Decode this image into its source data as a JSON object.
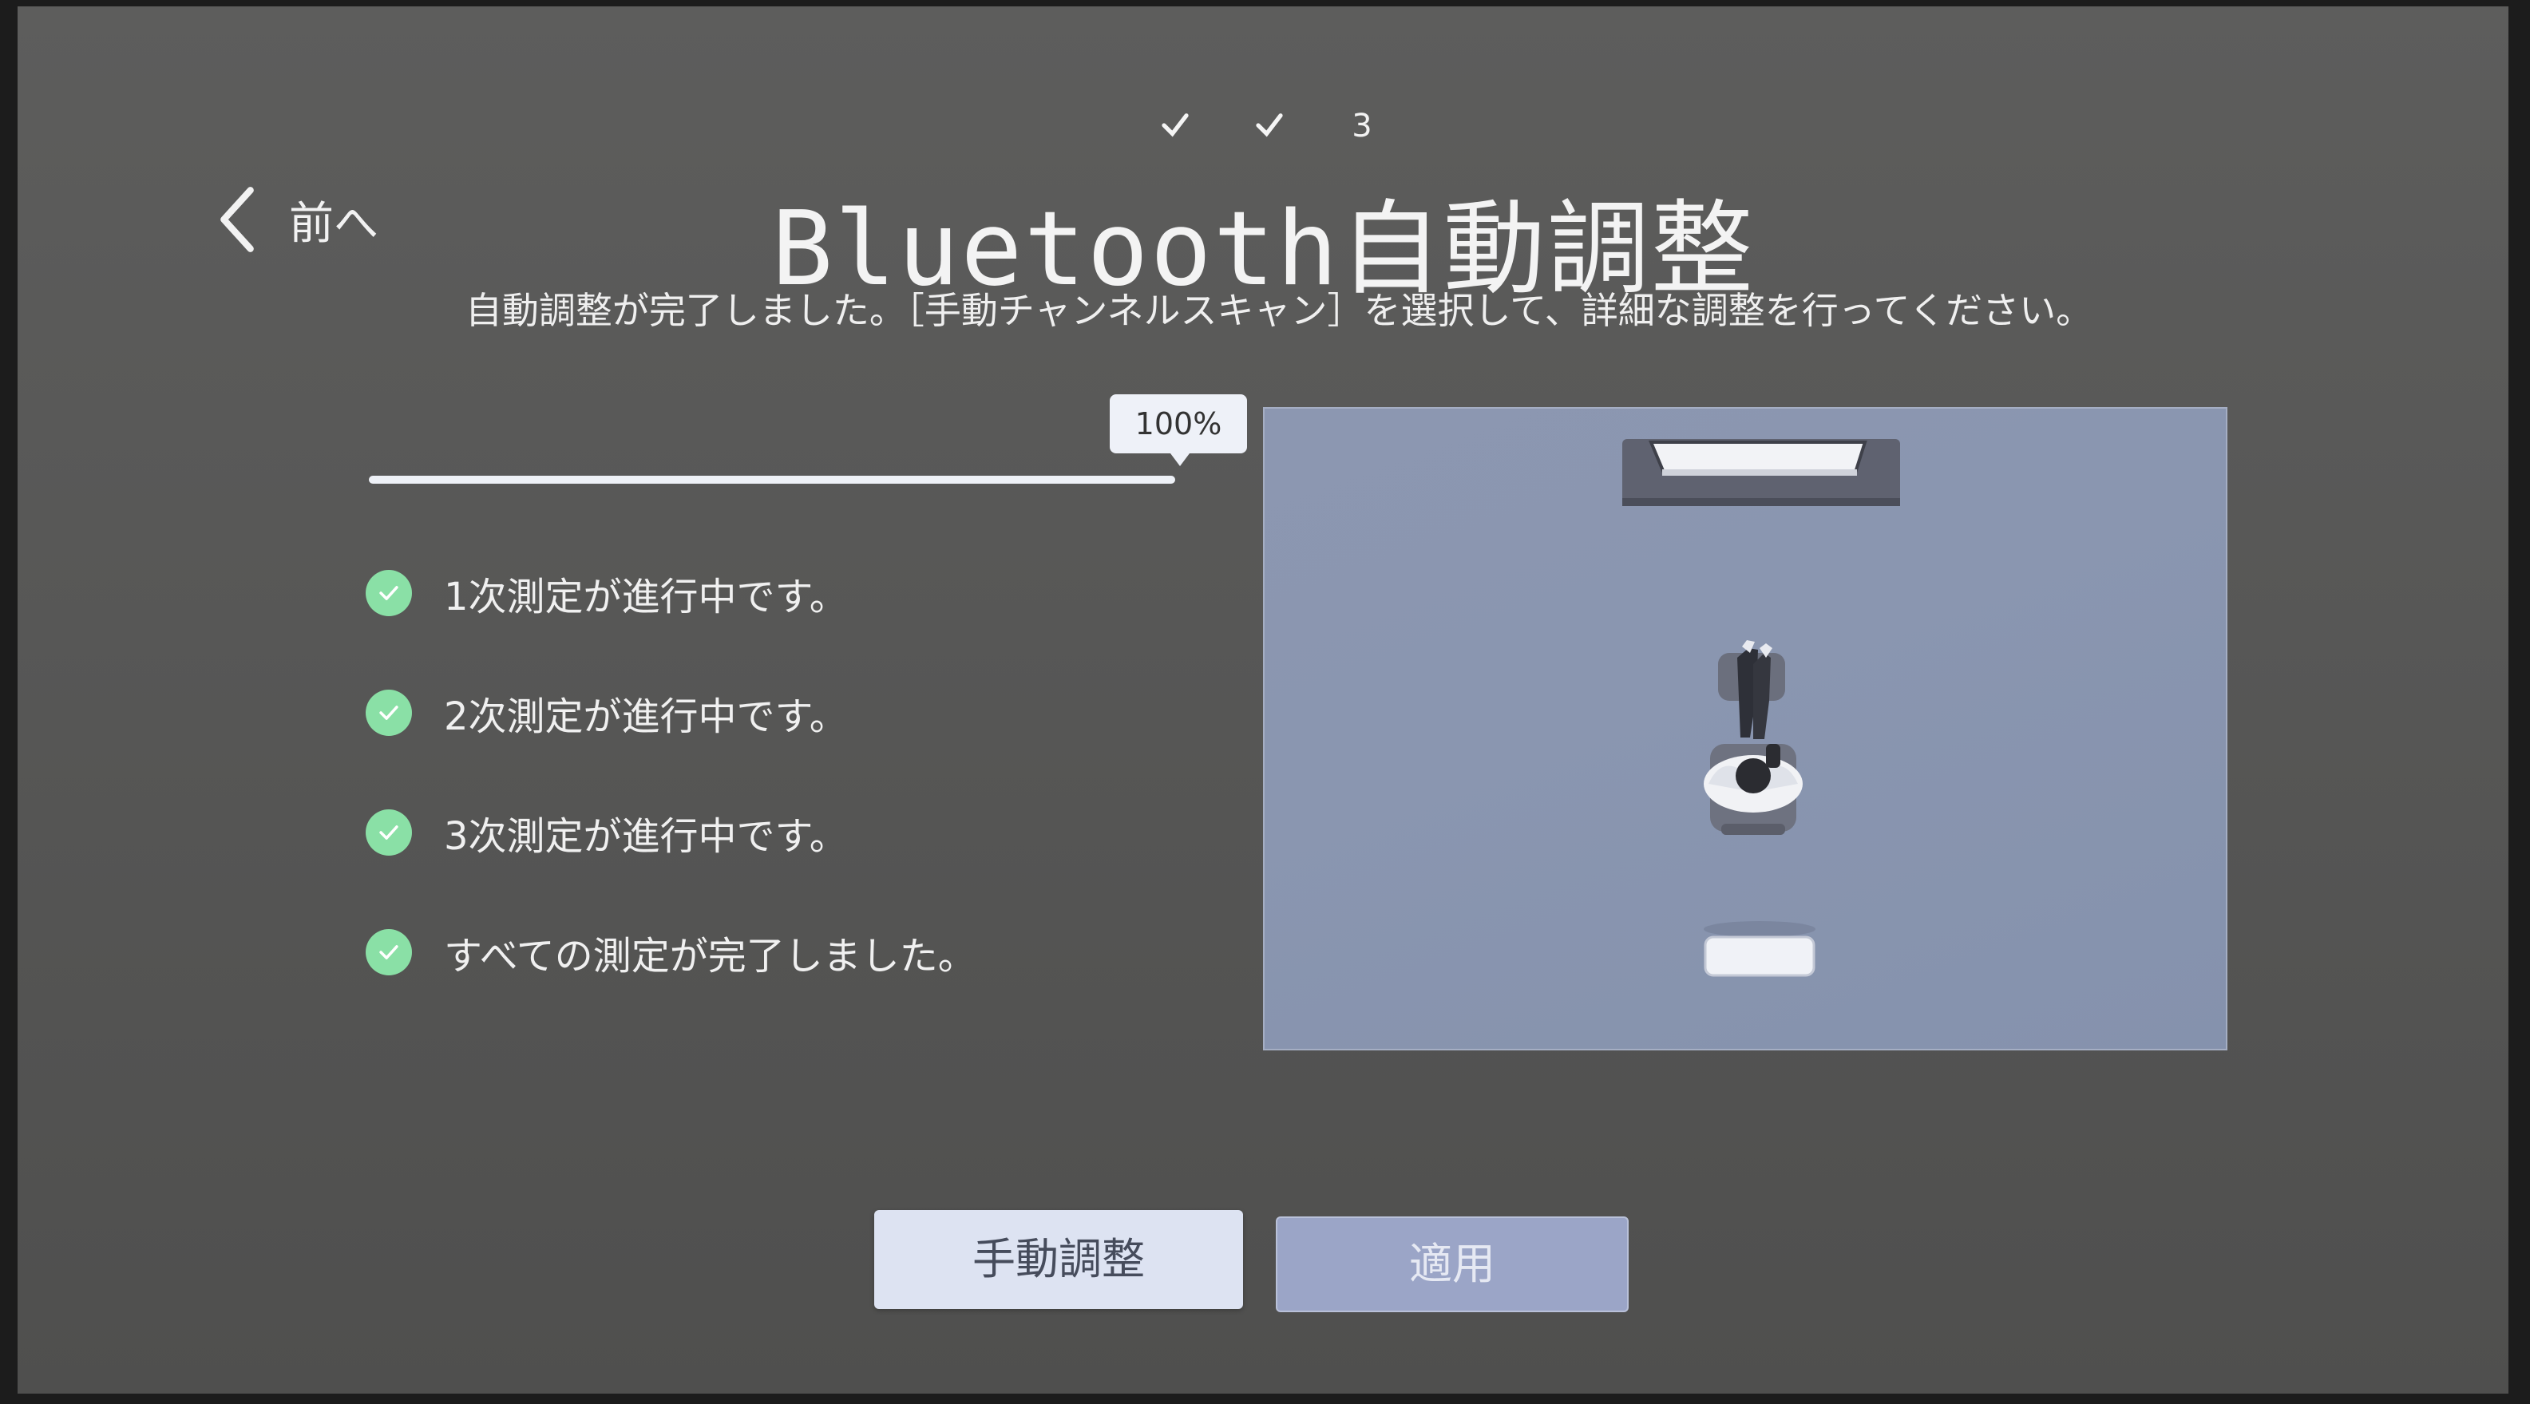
{
  "steps": [
    {
      "state": "done",
      "icon": "check-icon",
      "label": ""
    },
    {
      "state": "done",
      "icon": "check-icon",
      "label": ""
    },
    {
      "state": "current",
      "icon": "",
      "label": "3"
    }
  ],
  "header": {
    "back_label": "前へ",
    "title": "Bluetooth自動調整",
    "message": "自動調整が完了しました。［手動チャンネルスキャン］を選択して、詳細な調整を行ってください。"
  },
  "progress": {
    "value": 1.0,
    "label": "100%"
  },
  "checklist": [
    {
      "label": "1次測定が進行中です。",
      "status": "complete",
      "icon": "check-circle-icon"
    },
    {
      "label": "2次測定が進行中です。",
      "status": "complete",
      "icon": "check-circle-icon"
    },
    {
      "label": "3次測定が進行中です。",
      "status": "complete",
      "icon": "check-circle-icon"
    },
    {
      "label": "すべての測定が完了しました。",
      "status": "complete",
      "icon": "check-circle-icon"
    }
  ],
  "room_illustration": {
    "items": [
      "tv-icon",
      "listener-icon",
      "speaker-icon"
    ]
  },
  "buttons": {
    "manual_label": "手動調整",
    "apply_label": "適用"
  },
  "colors": {
    "check_green": "#8ae0a6",
    "room_bg": "#8a96b0",
    "primary_button": "#dde3f2",
    "secondary_button": "#9ba5c7"
  }
}
